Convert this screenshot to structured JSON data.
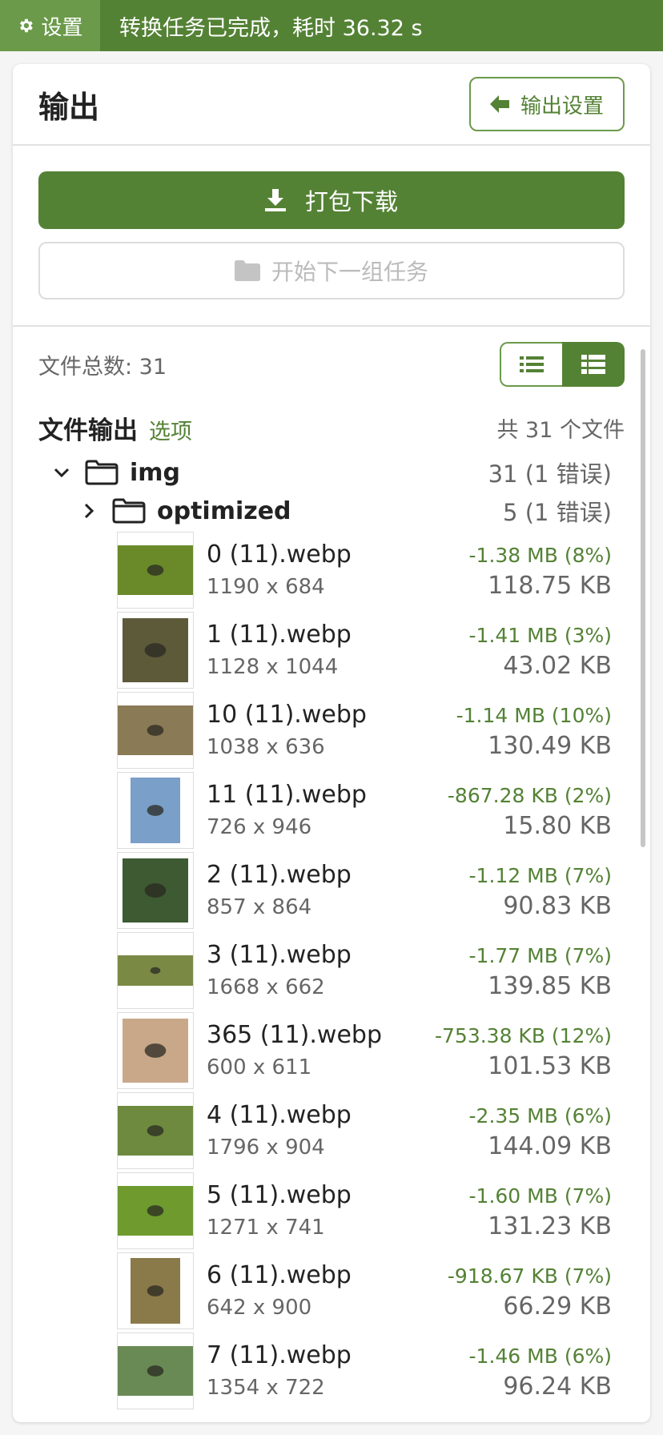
{
  "topbar": {
    "settings_label": "设置",
    "status": "转换任务已完成，耗时 36.32 s"
  },
  "card": {
    "title": "输出",
    "output_settings_label": "输出设置"
  },
  "actions": {
    "download_label": "打包下载",
    "next_label": "开始下一组任务"
  },
  "files": {
    "file_count_text": "文件总数: 31",
    "section_title": "文件输出",
    "options_label": "选项",
    "total_text": "共 31 个文件"
  },
  "tree": {
    "root": {
      "name": "img",
      "count": "31 (1 错误)"
    },
    "sub": {
      "name": "optimized",
      "count": "5 (1 错误)"
    }
  },
  "items": [
    {
      "name": "0 (11).webp",
      "dims": "1190 x 684",
      "saved": "-1.38 MB (8%)",
      "size": "118.75 KB",
      "thumb_color": "#6a8a2a",
      "orient": "land"
    },
    {
      "name": "1 (11).webp",
      "dims": "1128 x 1044",
      "saved": "-1.41 MB (3%)",
      "size": "43.02 KB",
      "thumb_color": "#5d5a3a",
      "orient": "sq"
    },
    {
      "name": "10 (11).webp",
      "dims": "1038 x 636",
      "saved": "-1.14 MB (10%)",
      "size": "130.49 KB",
      "thumb_color": "#8a7a55",
      "orient": "land"
    },
    {
      "name": "11 (11).webp",
      "dims": "726 x 946",
      "saved": "-867.28 KB (2%)",
      "size": "15.80 KB",
      "thumb_color": "#7a9fc8",
      "orient": "port"
    },
    {
      "name": "2 (11).webp",
      "dims": "857 x 864",
      "saved": "-1.12 MB (7%)",
      "size": "90.83 KB",
      "thumb_color": "#3d5a32",
      "orient": "sq"
    },
    {
      "name": "3 (11).webp",
      "dims": "1668 x 662",
      "saved": "-1.77 MB (7%)",
      "size": "139.85 KB",
      "thumb_color": "#7a8a45",
      "orient": "wide"
    },
    {
      "name": "365 (11).webp",
      "dims": "600 x 611",
      "saved": "-753.38 KB (12%)",
      "size": "101.53 KB",
      "thumb_color": "#c9a88a",
      "orient": "sq"
    },
    {
      "name": "4 (11).webp",
      "dims": "1796 x 904",
      "saved": "-2.35 MB (6%)",
      "size": "144.09 KB",
      "thumb_color": "#6d8a3e",
      "orient": "land"
    },
    {
      "name": "5 (11).webp",
      "dims": "1271 x 741",
      "saved": "-1.60 MB (7%)",
      "size": "131.23 KB",
      "thumb_color": "#6e9a2e",
      "orient": "land"
    },
    {
      "name": "6 (11).webp",
      "dims": "642 x 900",
      "saved": "-918.67 KB (7%)",
      "size": "66.29 KB",
      "thumb_color": "#8a7a4a",
      "orient": "port"
    },
    {
      "name": "7 (11).webp",
      "dims": "1354 x 722",
      "saved": "-1.46 MB (6%)",
      "size": "96.24 KB",
      "thumb_color": "#6a8a55",
      "orient": "land"
    }
  ],
  "colors": {
    "accent": "#548235",
    "topbar_settings": "#6a9a4a",
    "muted_text": "#666666",
    "border": "#e2e2e2"
  }
}
